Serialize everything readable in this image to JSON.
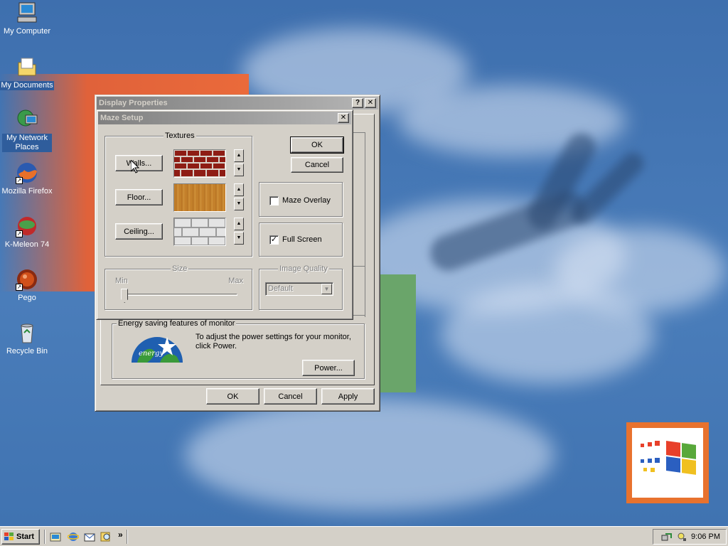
{
  "desktop": {
    "icons": [
      {
        "label": "My Computer",
        "icon": "computer-icon"
      },
      {
        "label": "My Documents",
        "icon": "folder-documents-icon"
      },
      {
        "label": "My Network Places",
        "icon": "network-places-icon"
      },
      {
        "label": "Mozilla Firefox",
        "icon": "firefox-icon"
      },
      {
        "label": "K-Meleon 74",
        "icon": "kmeleon-icon"
      },
      {
        "label": "Pego",
        "icon": "pego-icon"
      },
      {
        "label": "Recycle Bin",
        "icon": "recycle-bin-icon"
      }
    ]
  },
  "display_properties": {
    "title": "Display Properties",
    "help_glyph": "?",
    "close_glyph": "✕",
    "energy": {
      "group_label": "Energy saving features of monitor",
      "logo_text": "energy",
      "description": "To adjust the power settings for your monitor, click Power.",
      "power_button": "Power..."
    },
    "buttons": {
      "ok": "OK",
      "cancel": "Cancel",
      "apply": "Apply"
    }
  },
  "maze_setup": {
    "title": "Maze Setup",
    "close_glyph": "✕",
    "textures": {
      "group_label": "Textures",
      "walls": "Walls...",
      "floor": "Floor...",
      "ceiling": "Ceiling..."
    },
    "ok": "OK",
    "cancel": "Cancel",
    "maze_overlay": {
      "label": "Maze Overlay",
      "checked": false
    },
    "full_screen": {
      "label": "Full Screen",
      "checked": true,
      "check_glyph": "✓"
    },
    "size": {
      "group_label": "Size",
      "min_label": "Min",
      "max_label": "Max",
      "value": 0.02
    },
    "image_quality": {
      "group_label": "Image Quality",
      "selected": "Default"
    }
  },
  "taskbar": {
    "start_label": "Start",
    "chevron": "»",
    "clock": "9:06 PM"
  },
  "colors": {
    "desktop": "#4a7dba",
    "face": "#d4d0c8",
    "inactive_title": "#808080",
    "brick": "#8e1c14",
    "wood": "#c8862e"
  }
}
